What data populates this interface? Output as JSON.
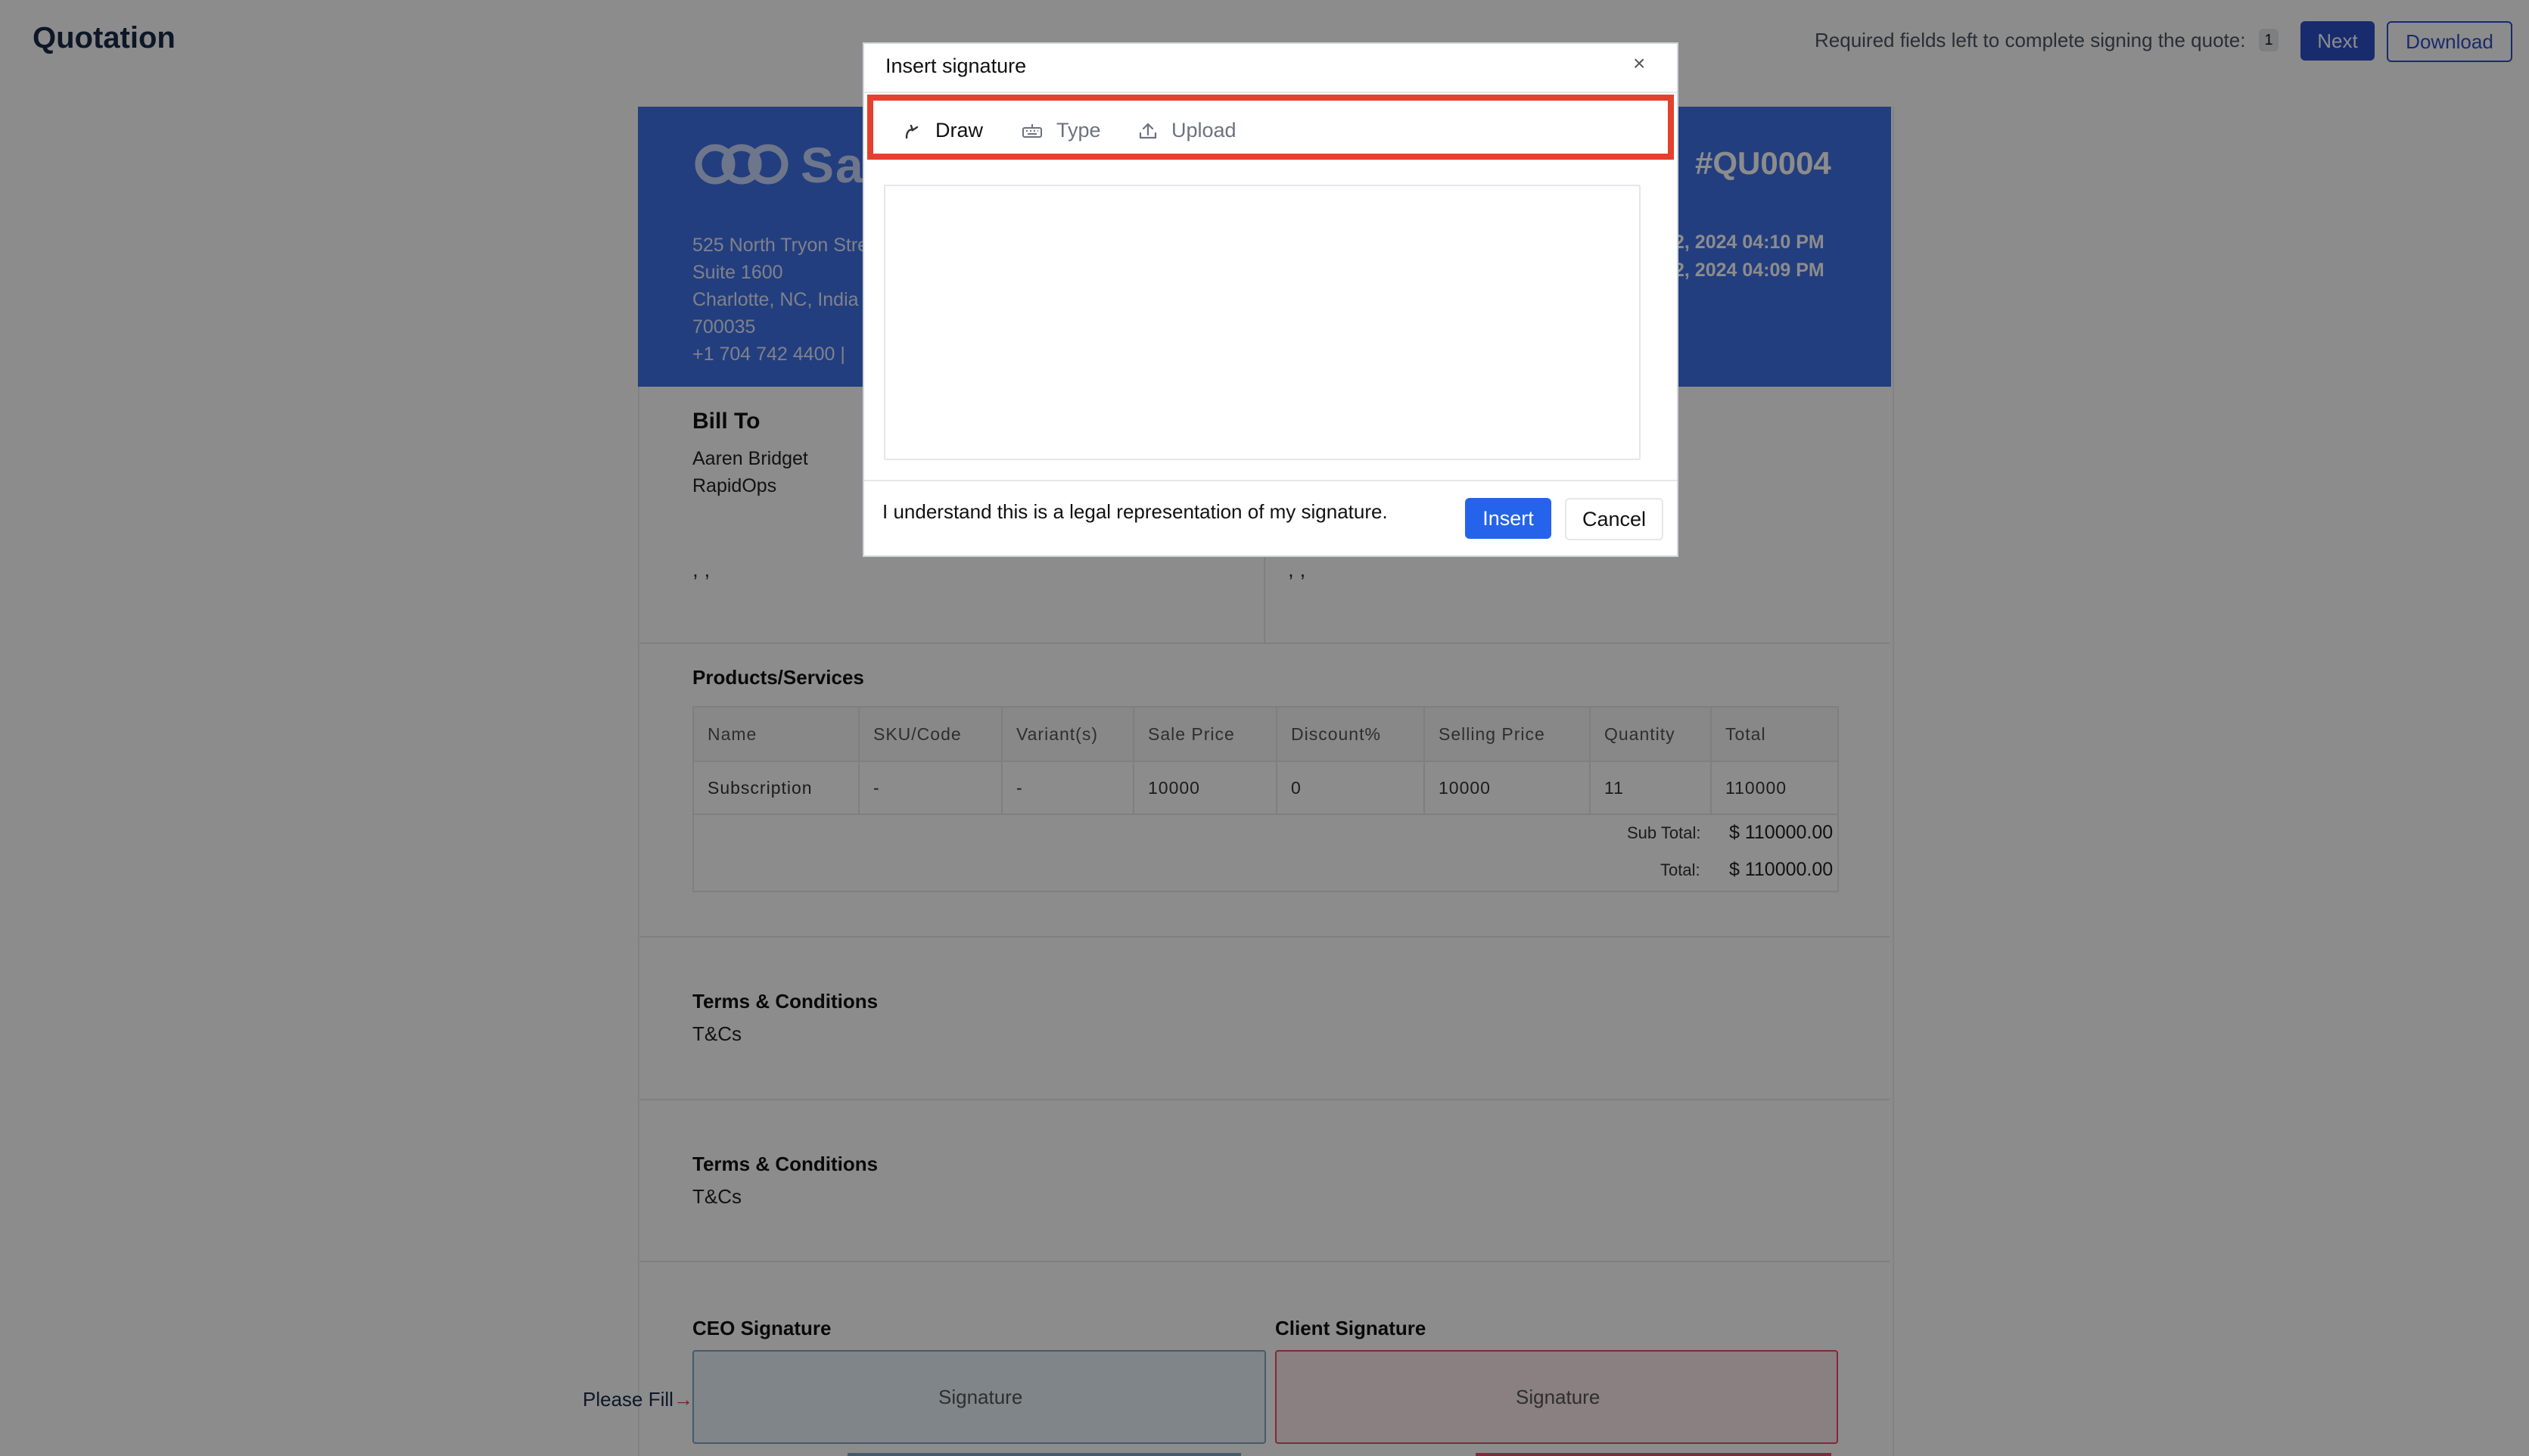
{
  "topbar": {
    "title": "Quotation",
    "required_text": "Required fields left to complete signing the quote:",
    "required_count": "1",
    "next_label": "Next",
    "download_label": "Download"
  },
  "header": {
    "logo_text": "Sa",
    "address": [
      "525 North Tryon Stre",
      "Suite 1600",
      "Charlotte, NC, India",
      "700035",
      "+1 704 742 4400  |"
    ],
    "quote_number": "#QU0004",
    "dates": [
      "2, 2024 04:10 PM",
      "2, 2024 04:09 PM"
    ],
    "color": "#4172e6"
  },
  "bill_to": {
    "title": "Bill To",
    "lines": [
      "Aaren Bridget",
      "RapidOps"
    ],
    "commas_left": ", ,",
    "commas_right": ", ,"
  },
  "products": {
    "title": "Products/Services",
    "columns": [
      "Name",
      "SKU/Code",
      "Variant(s)",
      "Sale Price",
      "Discount%",
      "Selling Price",
      "Quantity",
      "Total"
    ],
    "rows": [
      [
        "Subscription",
        "-",
        "-",
        "10000",
        "0",
        "10000",
        "11",
        "110000"
      ]
    ],
    "subtotal_label": "Sub Total:",
    "subtotal_value": "$ 110000.00",
    "total_label": "Total:",
    "total_value": "$ 110000.00"
  },
  "terms": [
    {
      "title": "Terms & Conditions",
      "text": "T&Cs"
    },
    {
      "title": "Terms & Conditions",
      "text": "T&Cs"
    }
  ],
  "signatures": {
    "ceo_title": "CEO Signature",
    "ceo_label": "Signature",
    "client_title": "Client Signature",
    "client_label": "Signature",
    "please_fill": "Please Fill",
    "arrow": "→"
  },
  "modal": {
    "title": "Insert signature",
    "close": "×",
    "tabs": [
      {
        "label": "Draw",
        "icon": "pen-draw-icon",
        "active": true
      },
      {
        "label": "Type",
        "icon": "keyboard-icon",
        "active": false
      },
      {
        "label": "Upload",
        "icon": "upload-icon",
        "active": false
      }
    ],
    "legal_text": "I understand this is a legal representation of my signature.",
    "insert_label": "Insert",
    "cancel_label": "Cancel",
    "highlight_color": "#e5402d"
  }
}
